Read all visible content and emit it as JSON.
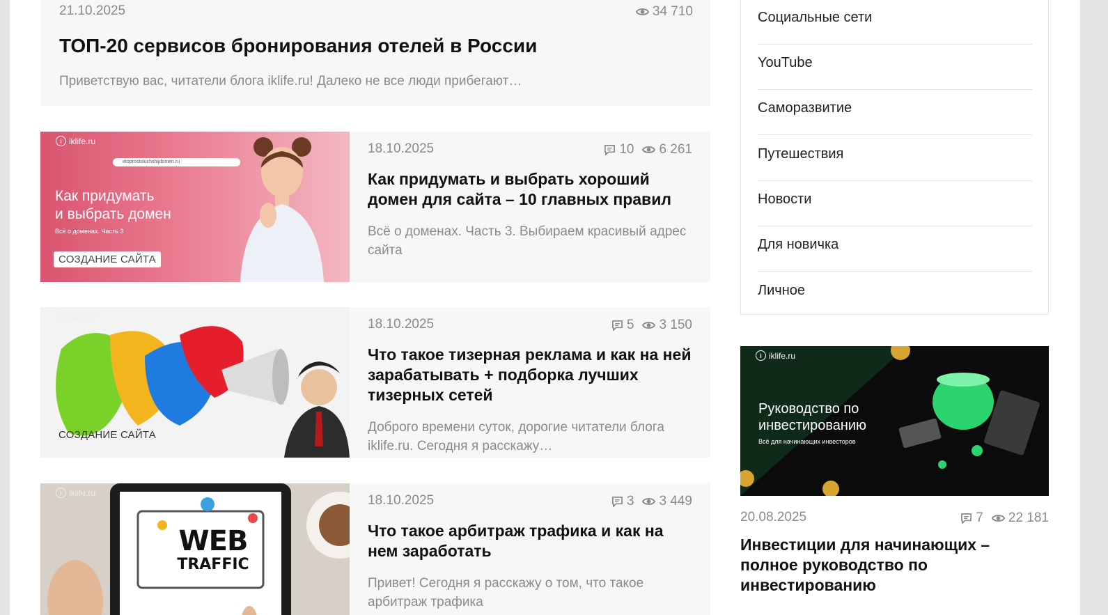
{
  "posts": [
    {
      "date": "21.10.2025",
      "views": "34 710",
      "title": "ТОП-20 сервисов бронирования отелей в России",
      "excerpt": "Приветствую вас, читатели блога iklife.ru! Далеко не все люди прибегают…"
    },
    {
      "date": "18.10.2025",
      "comments": "10",
      "views": "6 261",
      "title": "Как придумать и выбрать хороший домен для сайта – 10 главных правил",
      "excerpt": "Всё о доменах. Часть 3. Выбираем красивый адрес сайта",
      "thumb": {
        "logo": "iklife.ru",
        "url_bar": "etoprostoluchshijdomen.ru",
        "heading_line1": "Как придумать",
        "heading_line2": "и выбрать домен",
        "subheading": "Всё о доменах. Часть 3",
        "tag": "СОЗДАНИЕ САЙТА"
      }
    },
    {
      "date": "18.10.2025",
      "comments": "5",
      "views": "3 150",
      "title": "Что такое тизерная реклама и как на ней зарабатывать + подборка лучших тизерных сетей",
      "excerpt": "Доброго времени суток, дорогие читатели блога iklife.ru. Сегодня я расскажу…",
      "thumb": {
        "logo": "iklife.ru",
        "tag": "СОЗДАНИЕ САЙТА"
      }
    },
    {
      "date": "18.10.2025",
      "comments": "3",
      "views": "3 449",
      "title": "Что такое арбитраж трафика и как на нем заработать",
      "excerpt": "Привет! Сегодня я расскажу о том, что такое арбитраж трафика",
      "thumb": {
        "logo": "iklife.ru",
        "screen_line1": "WEB",
        "screen_line2": "TRAFFIC"
      }
    }
  ],
  "sidebar": {
    "categories": [
      "Социальные сети",
      "YouTube",
      "Саморазвитие",
      "Путешествия",
      "Новости",
      "Для новичка",
      "Личное"
    ],
    "featured": {
      "date": "20.08.2025",
      "comments": "7",
      "views": "22 181",
      "title": "Инвестиции для начинающих – полное руководство по инвестированию",
      "thumb": {
        "logo": "iklife.ru",
        "heading_line1": "Руководство по",
        "heading_line2": "инвестированию",
        "subheading": "Всё для начинающих инвесторов"
      }
    }
  },
  "icons": {
    "views": "eye-icon",
    "comments": "comment-icon"
  },
  "colors": {
    "card_bg": "#f7f7f7",
    "meta_text": "#8a8a8a",
    "thumb_pink": "#e8677d",
    "thumb_dark": "#0b0b0b",
    "accent_green": "#2bd46f"
  }
}
